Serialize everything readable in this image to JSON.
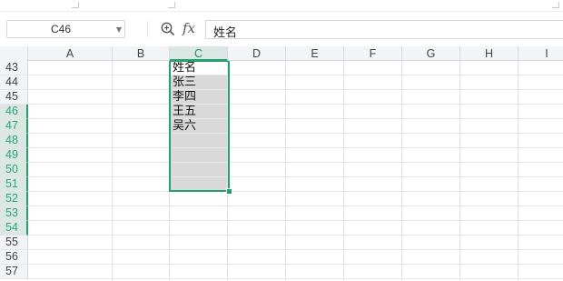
{
  "name_box": {
    "value": "C46"
  },
  "formula_bar": {
    "fx_label": "fx",
    "content": "姓名"
  },
  "columns": [
    "A",
    "B",
    "C",
    "D",
    "E",
    "F",
    "G",
    "H",
    "I"
  ],
  "selected_column": "C",
  "rows": [
    "43",
    "44",
    "45",
    "46",
    "47",
    "48",
    "49",
    "50",
    "51",
    "52",
    "53",
    "54",
    "55",
    "56",
    "57"
  ],
  "selected_rows": [
    "46",
    "47",
    "48",
    "49",
    "50",
    "51",
    "52",
    "53",
    "54"
  ],
  "cells": {
    "C46": "姓名",
    "C47": "张三",
    "C48": "李四",
    "C49": "王五",
    "C50": "吴六"
  },
  "colors": {
    "selection_accent": "#25a06e",
    "selection_fill": "#d9d9d9"
  },
  "icons": {
    "zoom": "magnifier-plus-icon",
    "dropdown": "chevron-down-icon"
  }
}
